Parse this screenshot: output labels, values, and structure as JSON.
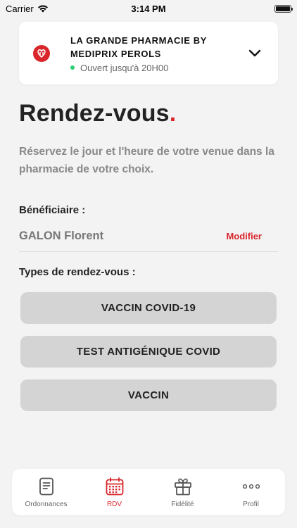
{
  "status_bar": {
    "carrier": "Carrier",
    "time": "3:14 PM"
  },
  "pharmacy": {
    "name": "LA GRANDE PHARMACIE BY MEDIPRIX PEROLS",
    "status": "Ouvert jusqu'à 20H00",
    "status_color": "#2ecc71",
    "logo_color": "#d8262b"
  },
  "page": {
    "title": "Rendez-vous",
    "title_dot": ".",
    "subtitle": "Réservez le jour et l'heure de votre venue dans la pharmacie de votre choix."
  },
  "beneficiary": {
    "label": "Bénéficiaire :",
    "name": "GALON Florent",
    "modify_label": "Modifier"
  },
  "appointment_types": {
    "label": "Types de rendez-vous :",
    "items": [
      {
        "label": "VACCIN COVID-19"
      },
      {
        "label": "TEST ANTIGÉNIQUE COVID"
      },
      {
        "label": "VACCIN"
      }
    ]
  },
  "tabs": [
    {
      "label": "Ordonnances",
      "icon": "prescription-icon",
      "active": false
    },
    {
      "label": "RDV",
      "icon": "calendar-icon",
      "active": true
    },
    {
      "label": "Fidélité",
      "icon": "gift-icon",
      "active": false
    },
    {
      "label": "Profil",
      "icon": "more-dots-icon",
      "active": false
    }
  ],
  "colors": {
    "accent": "#d8262b",
    "background": "#f3f3f3",
    "button_bg": "#d4d4d4"
  }
}
